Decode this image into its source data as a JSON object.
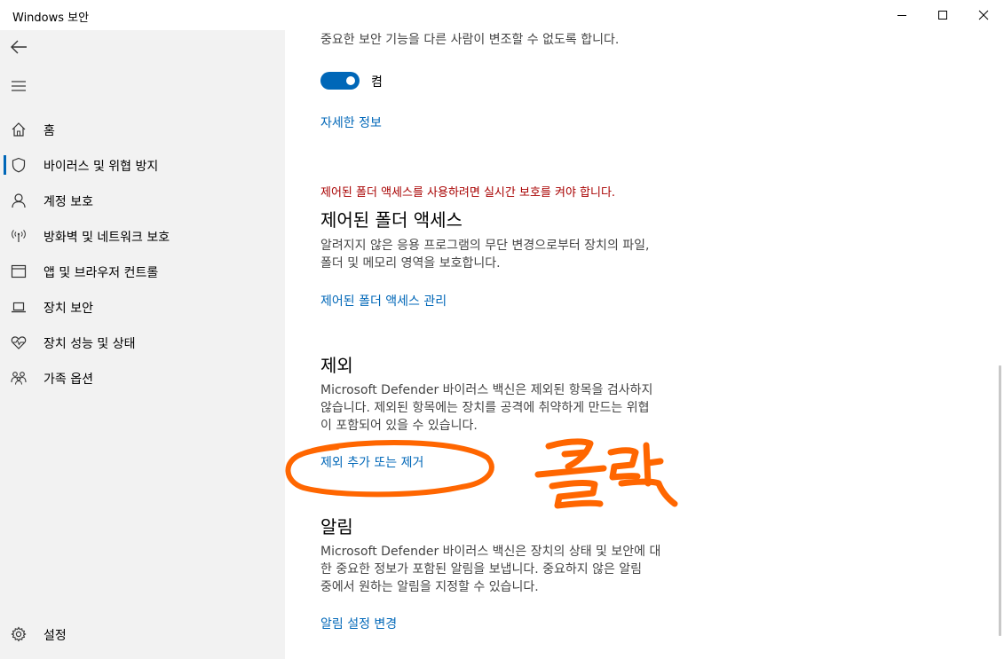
{
  "window": {
    "title": "Windows 보안"
  },
  "sidebar": {
    "items": [
      {
        "label": "홈",
        "icon": "home-icon"
      },
      {
        "label": "바이러스 및 위협 방지",
        "icon": "shield-icon",
        "selected": true
      },
      {
        "label": "계정 보호",
        "icon": "person-icon"
      },
      {
        "label": "방화벽 및 네트워크 보호",
        "icon": "wireless-icon"
      },
      {
        "label": "앱 및 브라우저 컨트롤",
        "icon": "browser-icon"
      },
      {
        "label": "장치 보안",
        "icon": "laptop-icon"
      },
      {
        "label": "장치 성능 및 상태",
        "icon": "heart-icon"
      },
      {
        "label": "가족 옵션",
        "icon": "family-icon"
      }
    ],
    "settings_label": "설정"
  },
  "main": {
    "tamper": {
      "desc": "중요한 보안 기능을 다른 사람이 변조할 수 없도록 합니다.",
      "toggle_label": "켬",
      "more_info_link": "자세한 정보"
    },
    "folder_access": {
      "warning": "제어된 폴더 액세스를 사용하려면 실시간 보호를 켜야 합니다.",
      "heading": "제어된 폴더 액세스",
      "desc_line1": "알려지지 않은 응용 프로그램의 무단 변경으로부터 장치의 파일,",
      "desc_line2": "폴더 및 메모리 영역을 보호합니다.",
      "link": "제어된 폴더 액세스 관리"
    },
    "exclusions": {
      "heading": "제외",
      "desc_line1": "Microsoft Defender 바이러스 백신은 제외된 항목을 검사하지",
      "desc_line2": "않습니다. 제외된 항목에는 장치를 공격에 취약하게 만드는 위협",
      "desc_line3": "이 포함되어 있을 수 있습니다.",
      "link": "제외 추가 또는 제거"
    },
    "notifications": {
      "heading": "알림",
      "desc_line1": "Microsoft Defender 바이러스 백신은 장치의 상태 및 보안에 대",
      "desc_line2": "한 중요한 정보가 포함된 알림을 보냅니다. 중요하지 않은 알림",
      "desc_line3": "중에서 원하는 알림을 지정할 수 있습니다.",
      "link": "알림 설정 변경"
    }
  },
  "colors": {
    "accent": "#0067b8",
    "warning": "#a80000",
    "annotation": "#ff6600"
  }
}
